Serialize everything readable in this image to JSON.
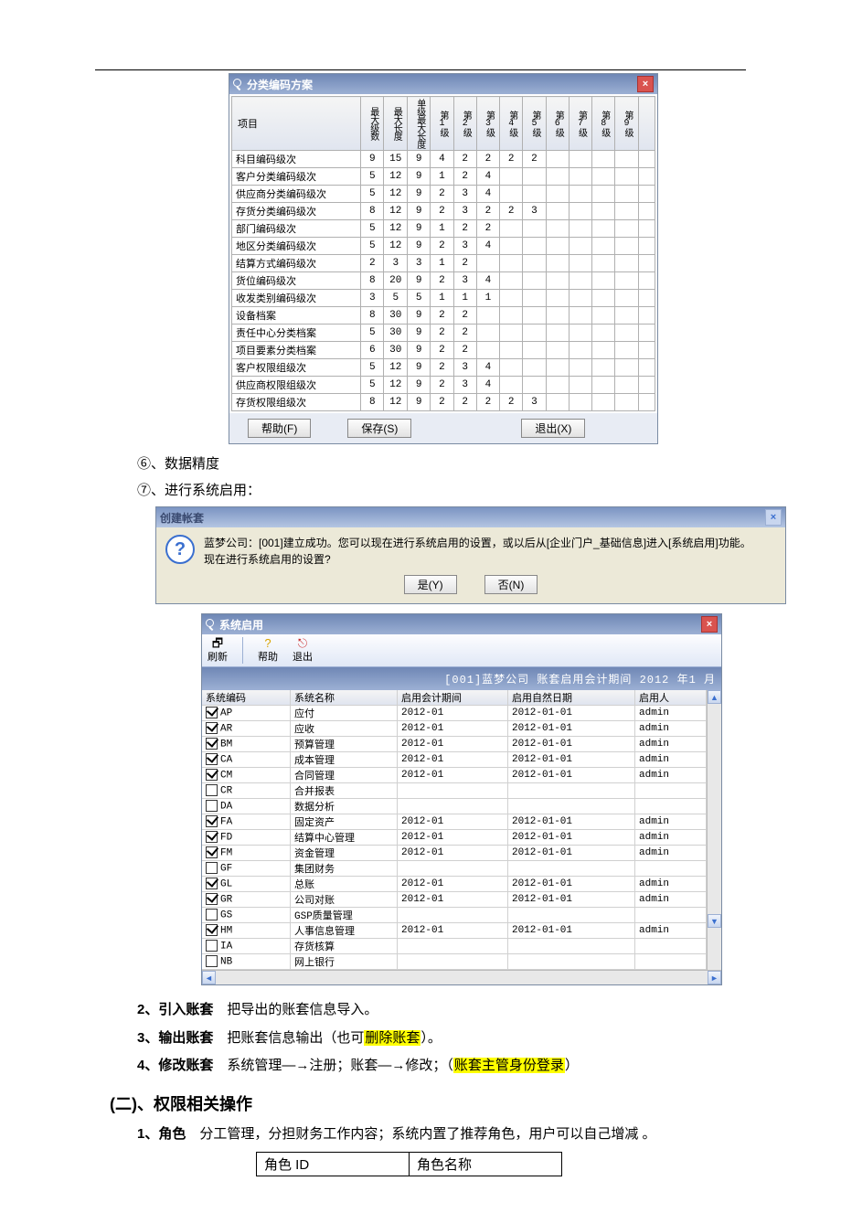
{
  "coding_scheme": {
    "title": "分类编码方案",
    "headers": {
      "project": "项目",
      "max_levels": "最大级数",
      "max_length": "最大长度",
      "single_max": "单级最大长度",
      "l1": "第1级",
      "l2": "第2级",
      "l3": "第3级",
      "l4": "第4级",
      "l5": "第5级",
      "l6": "第6级",
      "l7": "第7级",
      "l8": "第8级",
      "l9": "第9级"
    },
    "rows": [
      {
        "name": "科目编码级次",
        "mx": 9,
        "ml": 15,
        "sm": 9,
        "v": [
          4,
          2,
          2,
          2,
          2,
          "",
          "",
          "",
          ""
        ]
      },
      {
        "name": "客户分类编码级次",
        "mx": 5,
        "ml": 12,
        "sm": 9,
        "v": [
          1,
          2,
          4,
          "",
          "",
          "",
          "",
          "",
          ""
        ]
      },
      {
        "name": "供应商分类编码级次",
        "mx": 5,
        "ml": 12,
        "sm": 9,
        "v": [
          2,
          3,
          4,
          "",
          "",
          "",
          "",
          "",
          ""
        ]
      },
      {
        "name": "存货分类编码级次",
        "mx": 8,
        "ml": 12,
        "sm": 9,
        "v": [
          2,
          3,
          2,
          2,
          3,
          "",
          "",
          "",
          ""
        ]
      },
      {
        "name": "部门编码级次",
        "mx": 5,
        "ml": 12,
        "sm": 9,
        "v": [
          1,
          2,
          2,
          "",
          "",
          "",
          "",
          "",
          ""
        ]
      },
      {
        "name": "地区分类编码级次",
        "mx": 5,
        "ml": 12,
        "sm": 9,
        "v": [
          2,
          3,
          4,
          "",
          "",
          "",
          "",
          "",
          ""
        ]
      },
      {
        "name": "结算方式编码级次",
        "mx": 2,
        "ml": 3,
        "sm": 3,
        "v": [
          1,
          2,
          "",
          "",
          "",
          "",
          "",
          "",
          ""
        ]
      },
      {
        "name": "货位编码级次",
        "mx": 8,
        "ml": 20,
        "sm": 9,
        "v": [
          2,
          3,
          4,
          "",
          "",
          "",
          "",
          "",
          ""
        ]
      },
      {
        "name": "收发类别编码级次",
        "mx": 3,
        "ml": 5,
        "sm": 5,
        "v": [
          1,
          1,
          1,
          "",
          "",
          "",
          "",
          "",
          ""
        ]
      },
      {
        "name": "设备档案",
        "mx": 8,
        "ml": 30,
        "sm": 9,
        "v": [
          2,
          2,
          "",
          "",
          "",
          "",
          "",
          "",
          ""
        ]
      },
      {
        "name": "责任中心分类档案",
        "mx": 5,
        "ml": 30,
        "sm": 9,
        "v": [
          2,
          2,
          "",
          "",
          "",
          "",
          "",
          "",
          ""
        ]
      },
      {
        "name": "项目要素分类档案",
        "mx": 6,
        "ml": 30,
        "sm": 9,
        "v": [
          2,
          2,
          "",
          "",
          "",
          "",
          "",
          "",
          ""
        ]
      },
      {
        "name": "客户权限组级次",
        "mx": 5,
        "ml": 12,
        "sm": 9,
        "v": [
          2,
          3,
          4,
          "",
          "",
          "",
          "",
          "",
          ""
        ]
      },
      {
        "name": "供应商权限组级次",
        "mx": 5,
        "ml": 12,
        "sm": 9,
        "v": [
          2,
          3,
          4,
          "",
          "",
          "",
          "",
          "",
          ""
        ]
      },
      {
        "name": "存货权限组级次",
        "mx": 8,
        "ml": 12,
        "sm": 9,
        "v": [
          2,
          2,
          2,
          2,
          3,
          "",
          "",
          "",
          ""
        ]
      }
    ],
    "buttons": {
      "help": "帮助(F)",
      "save": "保存(S)",
      "exit": "退出(X)"
    }
  },
  "bullets": {
    "b6": "⑥、数据精度",
    "b7": "⑦、进行系统启用："
  },
  "confirm_dialog": {
    "title": "创建帐套",
    "msg": "蓝梦公司：[001]建立成功。您可以现在进行系统启用的设置，或以后从[企业门户_基础信息]进入[系统启用]功能。\n现在进行系统启用的设置?",
    "yes": "是(Y)",
    "no": "否(N)"
  },
  "system_enable": {
    "title": "系统启用",
    "toolbar": {
      "refresh": "刷新",
      "help": "帮助",
      "exit": "退出"
    },
    "subtitle": "[001]蓝梦公司 账套启用会计期间 2012 年1 月",
    "columns": {
      "code": "系统编码",
      "name": "系统名称",
      "period": "启用会计期间",
      "natdate": "启用自然日期",
      "user": "启用人"
    },
    "rows": [
      {
        "ck": true,
        "code": "AP",
        "name": "应付",
        "p": "2012-01",
        "d": "2012-01-01",
        "u": "admin"
      },
      {
        "ck": true,
        "code": "AR",
        "name": "应收",
        "p": "2012-01",
        "d": "2012-01-01",
        "u": "admin"
      },
      {
        "ck": true,
        "code": "BM",
        "name": "预算管理",
        "p": "2012-01",
        "d": "2012-01-01",
        "u": "admin"
      },
      {
        "ck": true,
        "code": "CA",
        "name": "成本管理",
        "p": "2012-01",
        "d": "2012-01-01",
        "u": "admin"
      },
      {
        "ck": true,
        "code": "CM",
        "name": "合同管理",
        "p": "2012-01",
        "d": "2012-01-01",
        "u": "admin"
      },
      {
        "ck": false,
        "code": "CR",
        "name": "合并报表",
        "p": "",
        "d": "",
        "u": ""
      },
      {
        "ck": false,
        "code": "DA",
        "name": "数据分析",
        "p": "",
        "d": "",
        "u": ""
      },
      {
        "ck": true,
        "code": "FA",
        "name": "固定资产",
        "p": "2012-01",
        "d": "2012-01-01",
        "u": "admin"
      },
      {
        "ck": true,
        "code": "FD",
        "name": "结算中心管理",
        "p": "2012-01",
        "d": "2012-01-01",
        "u": "admin"
      },
      {
        "ck": true,
        "code": "FM",
        "name": "资金管理",
        "p": "2012-01",
        "d": "2012-01-01",
        "u": "admin"
      },
      {
        "ck": false,
        "code": "GF",
        "name": "集团财务",
        "p": "",
        "d": "",
        "u": ""
      },
      {
        "ck": true,
        "code": "GL",
        "name": "总账",
        "p": "2012-01",
        "d": "2012-01-01",
        "u": "admin"
      },
      {
        "ck": true,
        "code": "GR",
        "name": "公司对账",
        "p": "2012-01",
        "d": "2012-01-01",
        "u": "admin"
      },
      {
        "ck": false,
        "code": "GS",
        "name": "GSP质量管理",
        "p": "",
        "d": "",
        "u": ""
      },
      {
        "ck": true,
        "code": "HM",
        "name": "人事信息管理",
        "p": "2012-01",
        "d": "2012-01-01",
        "u": "admin"
      },
      {
        "ck": false,
        "code": "IA",
        "name": "存货核算",
        "p": "",
        "d": "",
        "u": ""
      },
      {
        "ck": false,
        "code": "NB",
        "name": "网上银行",
        "p": "",
        "d": "",
        "u": ""
      }
    ]
  },
  "notes": {
    "n2_lead": "2、引入账套",
    "n2_tail": "把导出的账套信息导入。",
    "n3_lead": "3、输出账套",
    "n3_tail_1": "把账套信息输出（也可",
    "n3_hi": "删除账套",
    "n3_tail_2": "）。",
    "n4_lead": "4、修改账套",
    "n4_tail_1": "系统管理—→注册；账套—→修改；（",
    "n4_hi": "账套主管身份登录",
    "n4_tail_2": "）",
    "h2": "(二)、权限相关操作",
    "role_lead": "1、角色",
    "role_tail": "分工管理，分担财务工作内容；系统内置了推荐角色，用户可以自己增减 。",
    "role_table": {
      "c1": "角色 ID",
      "c2": "角色名称"
    }
  }
}
